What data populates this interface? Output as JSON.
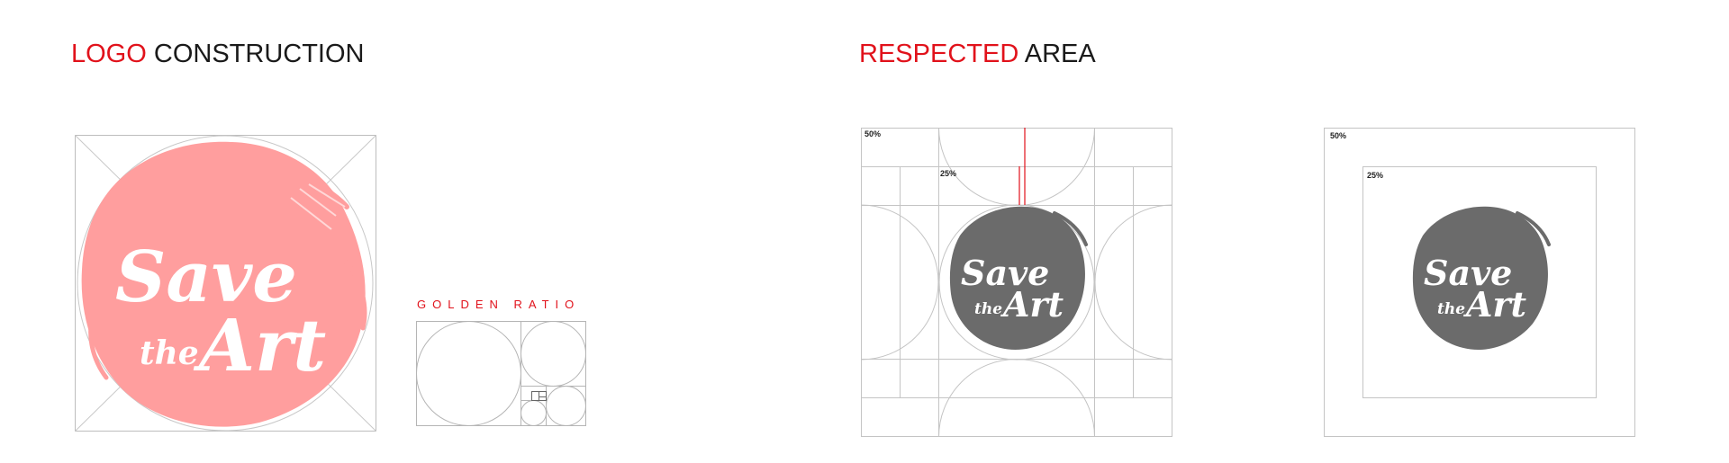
{
  "sections": {
    "logo_construction": {
      "accent": "LOGO",
      "rest": " CONSTRUCTION"
    },
    "respected_area": {
      "accent": "RESPECTED",
      "rest": " AREA"
    }
  },
  "golden_ratio": {
    "label": "GOLDEN RATIO"
  },
  "logo": {
    "line1": "Save",
    "line2_a": "the",
    "line2_b": "Art"
  },
  "clearspace": {
    "outer_label": "50%",
    "inner_label": "25%"
  },
  "colors": {
    "accent": "#e1121b",
    "logo_pink": "#ff9e9e",
    "logo_grey": "#6b6b6b",
    "guide_lines": "#bdbdbd"
  },
  "icons": [
    "brush-stroke-logo",
    "golden-ratio-spiral-grid",
    "clearspace-grid"
  ]
}
